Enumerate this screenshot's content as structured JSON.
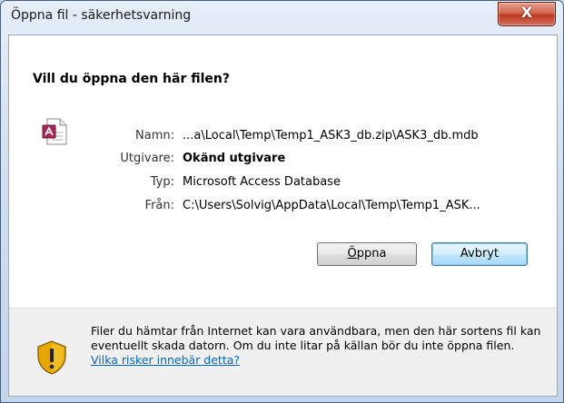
{
  "window": {
    "title": "Öppna fil - säkerhetsvarning",
    "close_label": "X"
  },
  "dialog": {
    "heading": "Vill du öppna den här filen?",
    "file_icon": "access-file-icon",
    "fields": [
      {
        "label": "Namn:",
        "value": "...a\\Local\\Temp\\Temp1_ASK3_db.zip\\ASK3_db.mdb"
      },
      {
        "label": "Utgivare:",
        "value": "Okänd utgivare"
      },
      {
        "label": "Typ:",
        "value": "Microsoft Access Database"
      },
      {
        "label": "Från:",
        "value": "C:\\Users\\Solvig\\AppData\\Local\\Temp\\Temp1_ASK..."
      }
    ],
    "buttons": {
      "open_underlined": "Ö",
      "open_rest": "ppna",
      "cancel": "Avbryt"
    }
  },
  "footer": {
    "icon": "security-warning-shield-icon",
    "text": "Filer du hämtar från Internet kan vara användbara, men den här sortens fil kan eventuellt skada datorn. Om du inte litar på källan bör du inte öppna filen.",
    "link": "Vilka risker innebär detta?"
  },
  "colors": {
    "accent": "#3c7fb1",
    "link": "#0066cc",
    "close": "#c9432a"
  }
}
